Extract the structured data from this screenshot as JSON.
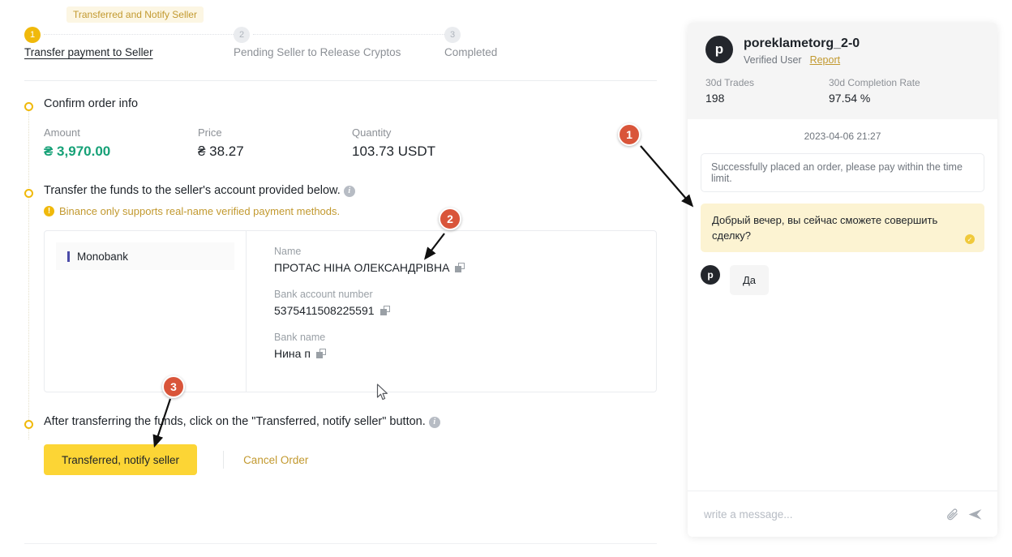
{
  "stepper": {
    "tooltip": "Transferred and Notify Seller",
    "steps": [
      {
        "num": "1",
        "label": "Transfer payment to Seller"
      },
      {
        "num": "2",
        "label": "Pending Seller to Release Cryptos"
      },
      {
        "num": "3",
        "label": "Completed"
      }
    ]
  },
  "order": {
    "confirm_title": "Confirm order info",
    "amount_label": "Amount",
    "amount_value": "₴ 3,970.00",
    "price_label": "Price",
    "price_value": "₴ 38.27",
    "quantity_label": "Quantity",
    "quantity_value": "103.73 USDT",
    "transfer_title": "Transfer the funds to the seller's account provided below.",
    "warning": "Binance only supports real-name verified payment methods.",
    "after_title": "After transferring the funds, click on the \"Transferred, notify seller\" button."
  },
  "payment": {
    "method": "Monobank",
    "fields": [
      {
        "label": "Name",
        "value": "ПРОТАС НІНА ОЛЕКСАНДРІВНА"
      },
      {
        "label": "Bank account number",
        "value": "5375411508225591"
      },
      {
        "label": "Bank name",
        "value": "Нина п"
      }
    ]
  },
  "actions": {
    "primary": "Transferred, notify seller",
    "cancel": "Cancel Order"
  },
  "chat": {
    "user": "poreklametorg_2-0",
    "avatar_letter": "p",
    "verified": "Verified User",
    "report": "Report",
    "stats": [
      {
        "label": "30d Trades",
        "value": "198"
      },
      {
        "label": "30d Completion Rate",
        "value": "97.54 %"
      }
    ],
    "timestamp": "2023-04-06 21:27",
    "system_message": "Successfully placed an order, please pay within the time limit.",
    "outgoing_message": "Добрый вечер, вы сейчас сможете совершить сделку?",
    "incoming_message": "Да",
    "incoming_avatar_letter": "p",
    "input_placeholder": "write a message...",
    "attach_icon": "paperclip-icon",
    "send_icon": "send-icon"
  },
  "annotations": [
    {
      "num": "1"
    },
    {
      "num": "2"
    },
    {
      "num": "3"
    }
  ],
  "colors": {
    "accent_yellow": "#f0b90b",
    "button_yellow": "#fcd535",
    "green": "#16a177",
    "annotation_red": "#d9553a",
    "gold_text": "#c2992f"
  }
}
